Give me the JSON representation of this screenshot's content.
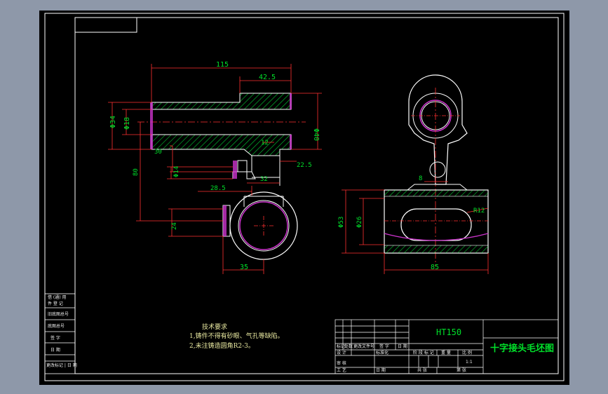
{
  "drawing": {
    "title": "十字接头毛坯图",
    "material": "HT150",
    "line_color": "#ffffff",
    "dim_color": "#ff3030",
    "text_color": "#00e02a",
    "hatch_color": "#00cc33",
    "paint_color": "#cc33cc"
  },
  "dimensions": {
    "len_115": "115",
    "len_42_5": "42.5",
    "phi_34": "Φ34",
    "phi_18": "Φ18",
    "phi_40": "Φ40",
    "d_30": "30",
    "d_12": "12",
    "d_22_5": "22.5",
    "phi_14": "Φ14",
    "d_28_5": "28.5",
    "d_32": "32",
    "d_80": "80",
    "d_24": "24",
    "d_35": "35",
    "d_8": "8",
    "r_12": "R12",
    "phi_53": "Φ53",
    "phi_26": "Φ26",
    "d_85": "85"
  },
  "notes": {
    "heading": "技术要求",
    "line1": "1,铸件不得有砂眼、气孔等缺陷。",
    "line2": "2,未注铸造圆角R2-3。"
  },
  "title_block": {
    "side_rows": [
      "借 (通) 用",
      "件 登 记",
      "旧底图总号",
      "底图总号",
      "签  字",
      "日  期",
      "更改标记 | 日  期"
    ],
    "rev_labels": [
      "标记",
      "处数",
      "更改文件号",
      "签  字",
      "日  期"
    ],
    "design_row": [
      "设  计",
      "标准化"
    ],
    "check_row": [
      "审  核"
    ],
    "approve_row": [
      "工  艺",
      "日  期"
    ],
    "stage_labels": [
      "阶 段 标 记",
      "重  量",
      "比  例"
    ],
    "scale": "1:1",
    "sheet": [
      "共  张",
      "第  张"
    ]
  }
}
